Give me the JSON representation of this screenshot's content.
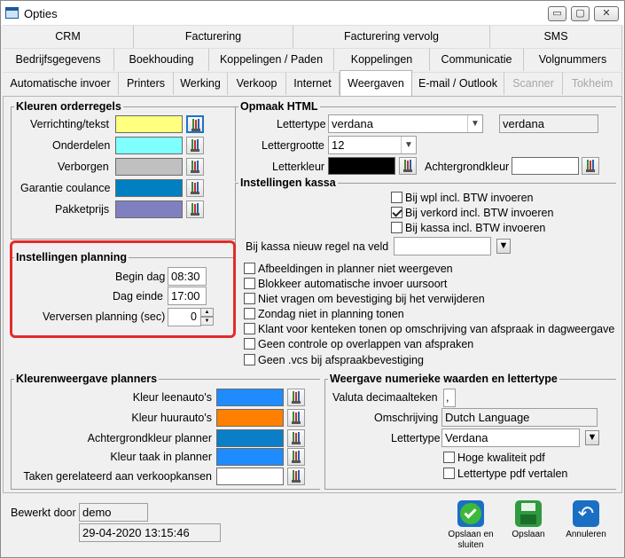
{
  "window": {
    "title": "Opties",
    "minimize": "▭",
    "maximize": "▢",
    "close": "✕"
  },
  "tabs_row1": [
    "CRM",
    "Facturering",
    "Facturering vervolg",
    "SMS"
  ],
  "tabs_row2": [
    "Bedrijfsgegevens",
    "Boekhouding",
    "Koppelingen / Paden",
    "Koppelingen",
    "Communicatie",
    "Volgnummers"
  ],
  "tabs_row3": [
    "Automatische invoer",
    "Printers",
    "Werking",
    "Verkoop",
    "Internet",
    "Weergaven",
    "E-mail / Outlook",
    "Scanner",
    "Tokheim"
  ],
  "kleuren_orderregels": {
    "title": "Kleuren orderregels",
    "rows": [
      {
        "label": "Verrichting/tekst",
        "color": "#ffff80"
      },
      {
        "label": "Onderdelen",
        "color": "#80ffff"
      },
      {
        "label": "Verborgen",
        "color": "#c0c0c0"
      },
      {
        "label": "Garantie coulance",
        "color": "#0080c0"
      },
      {
        "label": "Pakketprijs",
        "color": "#8080c0"
      }
    ]
  },
  "opmaak_html": {
    "title": "Opmaak HTML",
    "lettertype_label": "Lettertype",
    "lettertype_value": "verdana",
    "lettertype_display": "verdana",
    "lettergrootte_label": "Lettergrootte",
    "lettergrootte_value": "12",
    "letterkleur_label": "Letterkleur",
    "letterkleur_color": "#000000",
    "achtergrondkleur_label": "Achtergrondkleur",
    "achtergrondkleur_color": "#ffffff"
  },
  "instellingen_kassa": {
    "title": "Instellingen kassa",
    "checks": [
      {
        "label": "Bij wpl incl. BTW invoeren",
        "checked": false
      },
      {
        "label": "Bij verkord incl. BTW invoeren",
        "checked": true
      },
      {
        "label": "Bij kassa incl. BTW invoeren",
        "checked": false
      }
    ],
    "nieuw_regel_label": "Bij kassa nieuw regel na veld",
    "nieuw_regel_value": ""
  },
  "instellingen_planning": {
    "title": "Instellingen planning",
    "begin_label": "Begin dag",
    "begin_value": "08:30",
    "einde_label": "Dag einde",
    "einde_value": "17:00",
    "verversen_label": "Verversen planning (sec)",
    "verversen_value": "0"
  },
  "planner_checks": [
    {
      "label": "Afbeeldingen in planner niet weergeven",
      "checked": false
    },
    {
      "label": "Blokkeer automatische invoer uursoort",
      "checked": false
    },
    {
      "label": "Niet vragen om bevestiging bij het verwijderen",
      "checked": false
    },
    {
      "label": "Zondag niet in planning tonen",
      "checked": false
    },
    {
      "label": "Klant voor kenteken tonen op omschrijving van afspraak in dagweergave",
      "checked": false
    },
    {
      "label": "Geen controle op overlappen van afspraken",
      "checked": false
    },
    {
      "label": "Geen .vcs bij afspraakbevestiging",
      "checked": false
    }
  ],
  "kleurenweergave": {
    "title": "Kleurenweergave planners",
    "rows": [
      {
        "label": "Kleur leenauto's",
        "color": "#1e8cff"
      },
      {
        "label": "Kleur huurauto's",
        "color": "#ff8000"
      },
      {
        "label": "Achtergrondkleur planner",
        "color": "#0a7fc8"
      },
      {
        "label": "Kleur taak in planner",
        "color": "#1e8cff"
      },
      {
        "label": "Taken gerelateerd aan verkoopkansen",
        "color": "#ffffff"
      }
    ]
  },
  "numeriek": {
    "title": "Weergave numerieke waarden en lettertype",
    "valuta_label": "Valuta decimaalteken",
    "valuta_value": ",",
    "omschrijving_label": "Omschrijving",
    "omschrijving_value": "Dutch Language",
    "lettertype_label": "Lettertype",
    "lettertype_value": "Verdana",
    "checks": [
      {
        "label": "Hoge kwaliteit pdf",
        "checked": false
      },
      {
        "label": "Lettertype pdf vertalen",
        "checked": false
      }
    ]
  },
  "footer": {
    "bewerkt_label": "Bewerkt door",
    "bewerkt_value": "demo",
    "datum_value": "29-04-2020 13:15:46",
    "buttons": [
      {
        "label": "Opslaan en sluiten",
        "icon": "check-icon"
      },
      {
        "label": "Opslaan",
        "icon": "floppy-icon"
      },
      {
        "label": "Annuleren",
        "icon": "undo-icon"
      }
    ]
  }
}
